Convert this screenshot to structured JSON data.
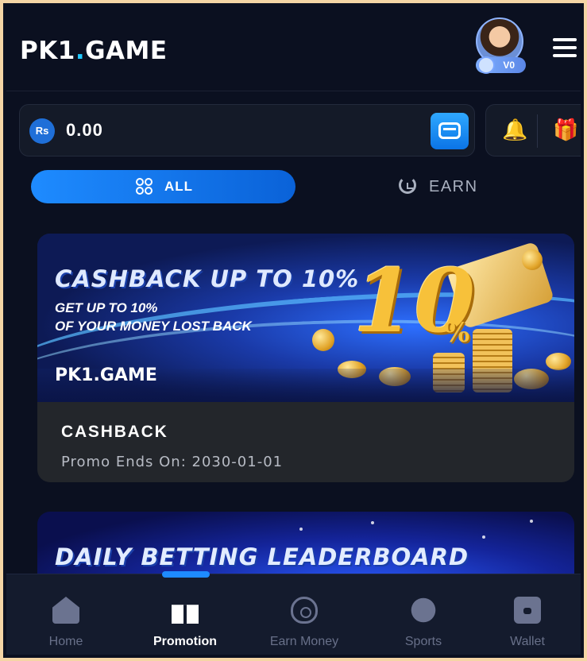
{
  "header": {
    "logo_main": "PK1",
    "logo_dot": ".",
    "logo_suffix": "GAME",
    "vip_level": "V0"
  },
  "wallet": {
    "currency_symbol": "Rs",
    "balance": "0.00"
  },
  "tabs": [
    {
      "label": "ALL",
      "active": true
    },
    {
      "label": "EARN",
      "active": false
    }
  ],
  "promotions": [
    {
      "banner_title": "CASHBACK UP TO 10%",
      "banner_line1": "GET UP TO 10%",
      "banner_line2": "OF YOUR MONEY LOST BACK",
      "banner_brand": "PK1.GAME",
      "banner_big": "10",
      "banner_pct": "%",
      "title": "CASHBACK",
      "subtitle": "Promo Ends On: 2030-01-01"
    },
    {
      "banner_title": "DAILY BETTING LEADERBOARD"
    }
  ],
  "bottom_nav": [
    {
      "label": "Home",
      "icon": "home-icon",
      "active": false
    },
    {
      "label": "Promotion",
      "icon": "gift-icon",
      "active": true
    },
    {
      "label": "Earn Money",
      "icon": "money-bag-icon",
      "active": false
    },
    {
      "label": "Sports",
      "icon": "sports-icon",
      "active": false
    },
    {
      "label": "Wallet",
      "icon": "wallet-icon",
      "active": false
    }
  ],
  "colors": {
    "accent": "#1e8bff",
    "background": "#0b1020",
    "gold": "#f7c13a"
  }
}
